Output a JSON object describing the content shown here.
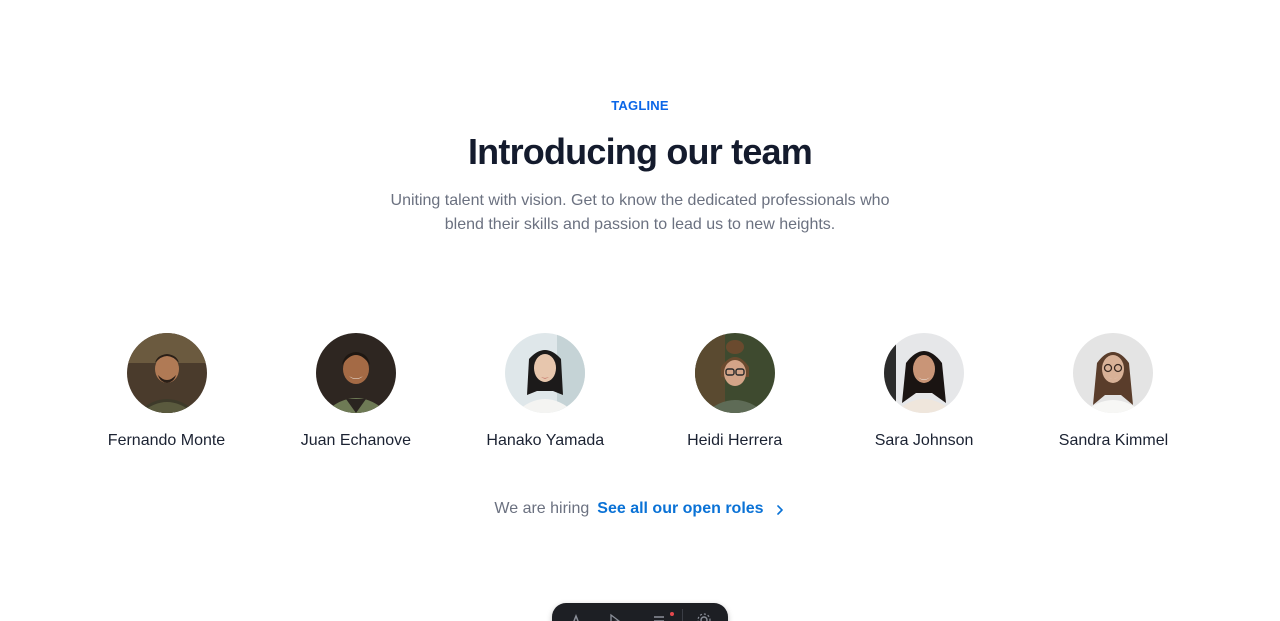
{
  "header": {
    "tagline": "TAGLINE",
    "title": "Introducing our team",
    "subtitle": "Uniting talent with vision. Get to know the dedicated professionals who blend their skills and passion to lead us to new heights."
  },
  "team": {
    "members": [
      {
        "name": "Fernando Monte"
      },
      {
        "name": "Juan Echanove"
      },
      {
        "name": "Hanako Yamada"
      },
      {
        "name": "Heidi Herrera"
      },
      {
        "name": "Sara Johnson"
      },
      {
        "name": "Sandra Kimmel"
      }
    ]
  },
  "hiring": {
    "text": "We are hiring",
    "link_label": "See all our open roles",
    "icon": "chevron-right-icon"
  },
  "toolbar": {
    "tools": [
      "text-icon",
      "cursor-icon",
      "menu-icon",
      "settings-icon"
    ]
  },
  "colors": {
    "accent": "#0a66e8",
    "link": "#0a72d6",
    "heading": "#141b2d",
    "muted": "#6b7180"
  }
}
